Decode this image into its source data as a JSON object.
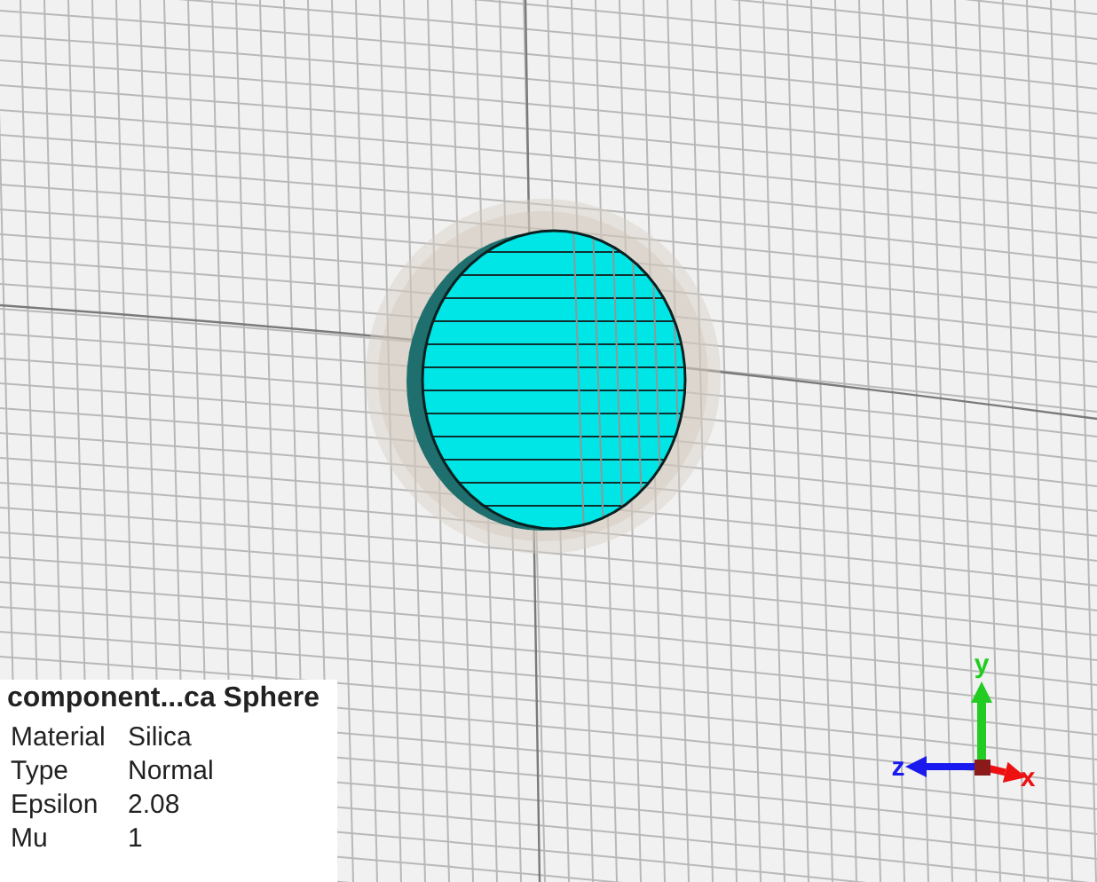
{
  "info_panel": {
    "title": "component...ca Sphere",
    "rows": [
      {
        "label": "Material",
        "value": "Silica"
      },
      {
        "label": "Type",
        "value": "Normal"
      },
      {
        "label": "Epsilon",
        "value": "2.08"
      },
      {
        "label": "Mu",
        "value": "1"
      }
    ]
  },
  "axes": [
    {
      "kind": "y",
      "label": "y",
      "color": "#22cc22"
    },
    {
      "kind": "z",
      "label": "z",
      "color": "#1a1aee"
    },
    {
      "kind": "x",
      "label": "x",
      "color": "#ee1111"
    }
  ]
}
